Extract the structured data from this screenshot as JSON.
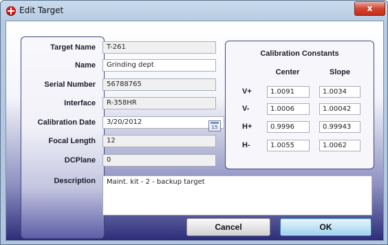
{
  "window": {
    "title": "Edit Target",
    "close_label": "x"
  },
  "form": {
    "target_name": {
      "label": "Target Name",
      "value": "T-261"
    },
    "name": {
      "label": "Name",
      "value": "Grinding dept"
    },
    "serial_number": {
      "label": "Serial Number",
      "value": "56788765"
    },
    "interface": {
      "label": "Interface",
      "value": "R-358HR"
    },
    "calibration_date": {
      "label": "Calibration Date",
      "value": "3/20/2012",
      "calendar_icon_text": "15"
    },
    "focal_length": {
      "label": "Focal Length",
      "value": "12"
    },
    "dcplane": {
      "label": "DCPlane",
      "value": "0"
    },
    "description": {
      "label": "Description",
      "value": "Maint. kit - 2 - backup target"
    }
  },
  "calibration": {
    "title": "Calibration Constants",
    "col_center": "Center",
    "col_slope": "Slope",
    "rows": [
      {
        "label": "V+",
        "center": "1.0091",
        "slope": "1.0034"
      },
      {
        "label": "V-",
        "center": "1.0006",
        "slope": "1.00042"
      },
      {
        "label": "H+",
        "center": "0.9996",
        "slope": "0.99943"
      },
      {
        "label": "H-",
        "center": "1.0055",
        "slope": "1.0062"
      }
    ]
  },
  "buttons": {
    "cancel": "Cancel",
    "ok": "OK"
  },
  "colors": {
    "panel_border": "#3f4581",
    "ok_button": "#9bd0ee",
    "close_button": "#c12e19",
    "gradient_bottom": "#2d2c7a"
  }
}
